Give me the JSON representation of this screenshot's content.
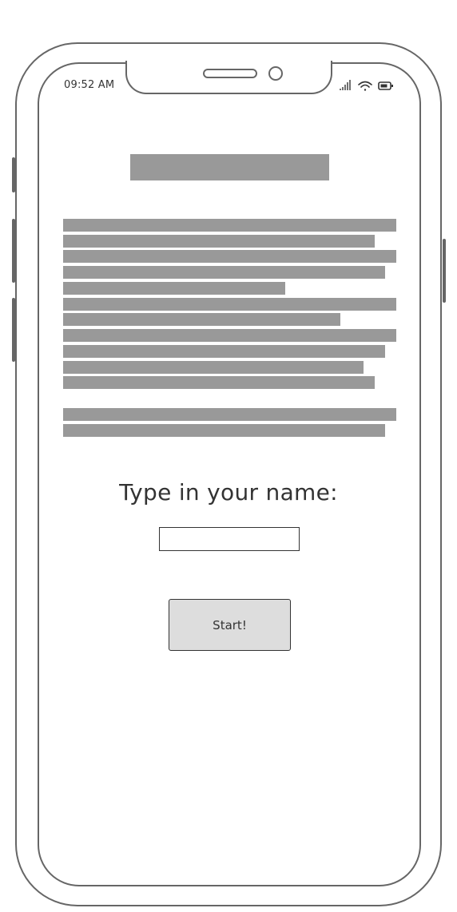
{
  "status_bar": {
    "time": "09:52 AM",
    "icons": [
      "signal-icon",
      "wifi-icon",
      "battery-icon"
    ]
  },
  "form": {
    "prompt": "Type in your name:",
    "name_value": "",
    "start_label": "Start!"
  },
  "colors": {
    "frame": "#666666",
    "placeholder_block": "#999999",
    "button_fill": "#dddddd",
    "text": "#333333"
  }
}
